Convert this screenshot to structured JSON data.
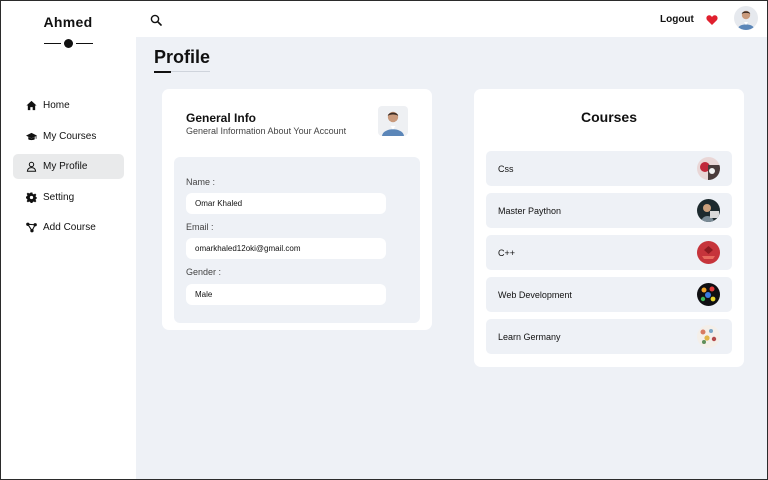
{
  "sidebar": {
    "brand": "Ahmed",
    "items": [
      {
        "label": "Home",
        "icon": "home-icon"
      },
      {
        "label": "My Courses",
        "icon": "graduation-cap-icon"
      },
      {
        "label": "My Profile",
        "icon": "user-icon",
        "active": true
      },
      {
        "label": "Setting",
        "icon": "gear-icon"
      },
      {
        "label": "Add Course",
        "icon": "share-nodes-icon"
      }
    ]
  },
  "topbar": {
    "search_icon": "search-icon",
    "logout_label": "Logout",
    "heart_icon": "heart-icon",
    "heart_color": "#e0202e"
  },
  "page": {
    "title": "Profile"
  },
  "general_info": {
    "title": "General Info",
    "subtitle": "General Information About Your Account",
    "fields": [
      {
        "label": "Name :",
        "value": "Omar Khaled"
      },
      {
        "label": "Email :",
        "value": "omarkhaled12oki@gmail.com"
      },
      {
        "label": "Gender :",
        "value": "Male"
      }
    ]
  },
  "courses": {
    "title": "Courses",
    "items": [
      {
        "name": "Css"
      },
      {
        "name": "Master Paython"
      },
      {
        "name": "C++"
      },
      {
        "name": "Web Development"
      },
      {
        "name": "Learn Germany"
      }
    ]
  },
  "colors": {
    "background": "#eef1f6",
    "card": "#ffffff",
    "text": "#111111"
  }
}
